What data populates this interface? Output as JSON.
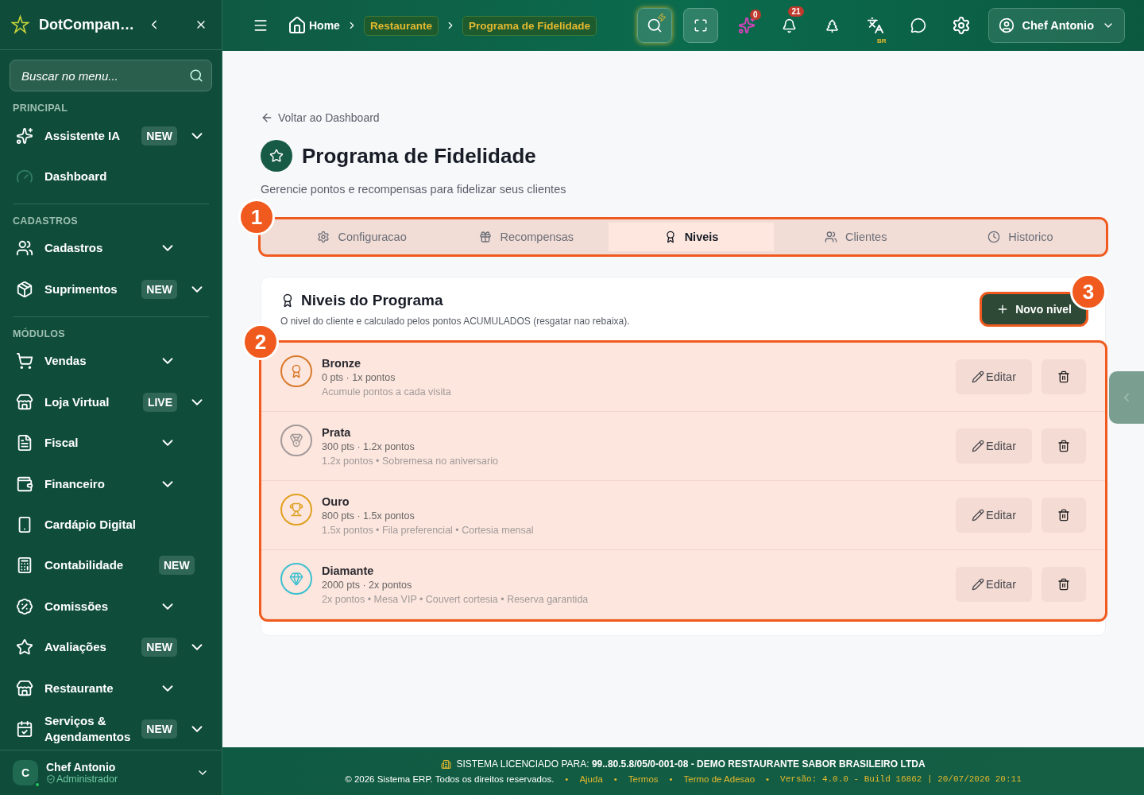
{
  "sidebar": {
    "brand": "DotCompan…",
    "search": {
      "placeholder": "Buscar no menu..."
    },
    "sections": [
      {
        "title": "PRINCIPAL",
        "items": [
          {
            "label": "Assistente IA",
            "badge": "NEW",
            "expandable": true
          },
          {
            "label": "Dashboard",
            "expandable": false
          }
        ]
      },
      {
        "title": "CADASTROS",
        "items": [
          {
            "label": "Cadastros",
            "expandable": true
          },
          {
            "label": "Suprimentos",
            "badge": "NEW",
            "expandable": true
          }
        ]
      },
      {
        "title": "MÓDULOS",
        "items": [
          {
            "label": "Vendas",
            "expandable": true
          },
          {
            "label": "Loja Virtual",
            "badge": "LIVE",
            "expandable": true
          },
          {
            "label": "Fiscal",
            "expandable": true
          },
          {
            "label": "Financeiro",
            "expandable": true
          },
          {
            "label": "Cardápio Digital",
            "expandable": false
          },
          {
            "label": "Contabilidade",
            "badge": "NEW",
            "expandable": false
          },
          {
            "label": "Comissões",
            "expandable": true
          },
          {
            "label": "Avaliações",
            "badge": "NEW",
            "expandable": true
          },
          {
            "label": "Restaurante",
            "expandable": true
          },
          {
            "label": "Serviços & Agendamentos",
            "badge": "NEW",
            "expandable": true
          }
        ]
      }
    ],
    "user": {
      "initial": "C",
      "name": "Chef Antonio",
      "role": "Administrador"
    }
  },
  "header": {
    "breadcrumb": [
      {
        "label": "Home",
        "kind": "home"
      },
      {
        "label": "Restaurante",
        "kind": "chip"
      },
      {
        "label": "Programa de Fidelidade",
        "kind": "chip"
      }
    ],
    "sparkle_count": "0",
    "notification_count": "21",
    "language": "BR",
    "user": "Chef Antonio"
  },
  "page": {
    "back": "Voltar ao Dashboard",
    "title": "Programa de Fidelidade",
    "subtitle": "Gerencie pontos e recompensas para fidelizar seus clientes",
    "tabs": [
      {
        "label": "Configuracao",
        "selected": false
      },
      {
        "label": "Recompensas",
        "selected": false
      },
      {
        "label": "Niveis",
        "selected": true
      },
      {
        "label": "Clientes",
        "selected": false
      },
      {
        "label": "Historico",
        "selected": false
      }
    ],
    "tabs_callout": "1",
    "levels_card": {
      "title": "Niveis do Programa",
      "description": "O nivel do cliente e calculado pelos pontos ACUMULADOS (resgatar nao rebaixa).",
      "new_button": "Novo nivel",
      "new_button_callout": "3",
      "list_callout": "2",
      "levels": [
        {
          "name": "Bronze",
          "points": "0 pts · 1x pontos",
          "perks": "Acumule pontos a cada visita",
          "color": "#d97a2b",
          "edit": "Editar"
        },
        {
          "name": "Prata",
          "points": "300 pts · 1.2x pontos",
          "perks": "1.2x pontos • Sobremesa no aniversario",
          "color": "#a39a9a",
          "edit": "Editar"
        },
        {
          "name": "Ouro",
          "points": "800 pts · 1.5x pontos",
          "perks": "1.5x pontos • Fila preferencial • Cortesia mensal",
          "color": "#e0a020",
          "edit": "Editar"
        },
        {
          "name": "Diamante",
          "points": "2000 pts · 2x pontos",
          "perks": "2x pontos • Mesa VIP • Couvert cortesia • Reserva garantida",
          "color": "#3cc0d0",
          "edit": "Editar"
        }
      ]
    }
  },
  "footer": {
    "license": "SISTEMA LICENCIADO PARA: **99..80.5.8/05/0-001-08 - DEMO RESTAURANTE SABOR BRASILEIRO LTDA**",
    "items": [
      {
        "kind": "text",
        "text": "© 2026 Sistema ERP. Todos os direitos reservados."
      },
      {
        "kind": "dot",
        "text": "•"
      },
      {
        "kind": "link",
        "text": "Ajuda"
      },
      {
        "kind": "dot",
        "text": "•"
      },
      {
        "kind": "link",
        "text": "Termos"
      },
      {
        "kind": "dot",
        "text": "•"
      },
      {
        "kind": "link",
        "text": "Termo de Adesao"
      },
      {
        "kind": "dot",
        "text": "•"
      },
      {
        "kind": "version",
        "text": "Versão: 4.0.0 - Build 16862 | 20/07/2026 20:11"
      }
    ]
  }
}
